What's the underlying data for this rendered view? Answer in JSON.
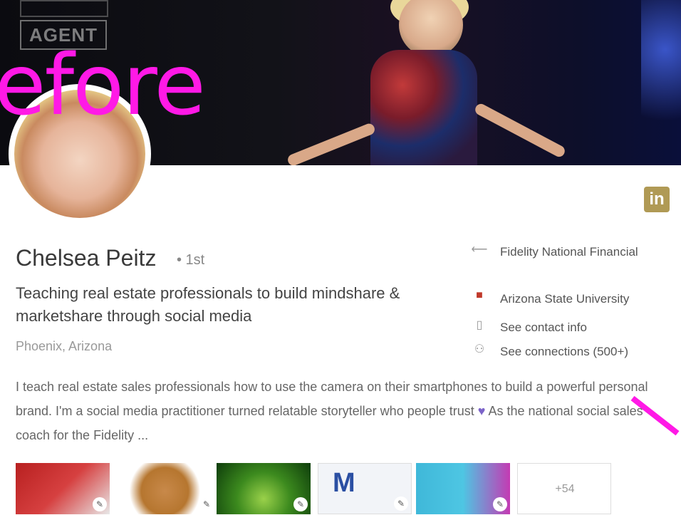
{
  "profile": {
    "name": "Chelsea Peitz",
    "degree": "• 1st",
    "headline": "Teaching real estate professionals to build mindshare & marketshare through social media",
    "location": "Phoenix, Arizona"
  },
  "cover": {
    "logo_text": "AGENT"
  },
  "badge": "in",
  "watermark": "efore",
  "side": {
    "company": "Fidelity National Financial",
    "school": "Arizona State University",
    "contact": "See contact info",
    "connections": "See connections (500+)"
  },
  "summary": {
    "text_before_heart": "I teach real estate sales professionals how to use the camera on their smartphones to build a powerful personal brand. I'm a social media practitioner turned relatable storyteller who people trust ",
    "heart": "♥",
    "text_after_heart": " As the national social sales coach for the Fidelity ..."
  },
  "media": {
    "more_count": "+54",
    "pen": "✎"
  },
  "icons": {
    "company": "arrow-icon",
    "school": "school-icon",
    "contact": "contact-icon",
    "connections": "people-icon"
  },
  "colors": {
    "watermark": "#ff19e6",
    "linkedin_badge": "#b09a55",
    "heart": "#7b63c8"
  }
}
